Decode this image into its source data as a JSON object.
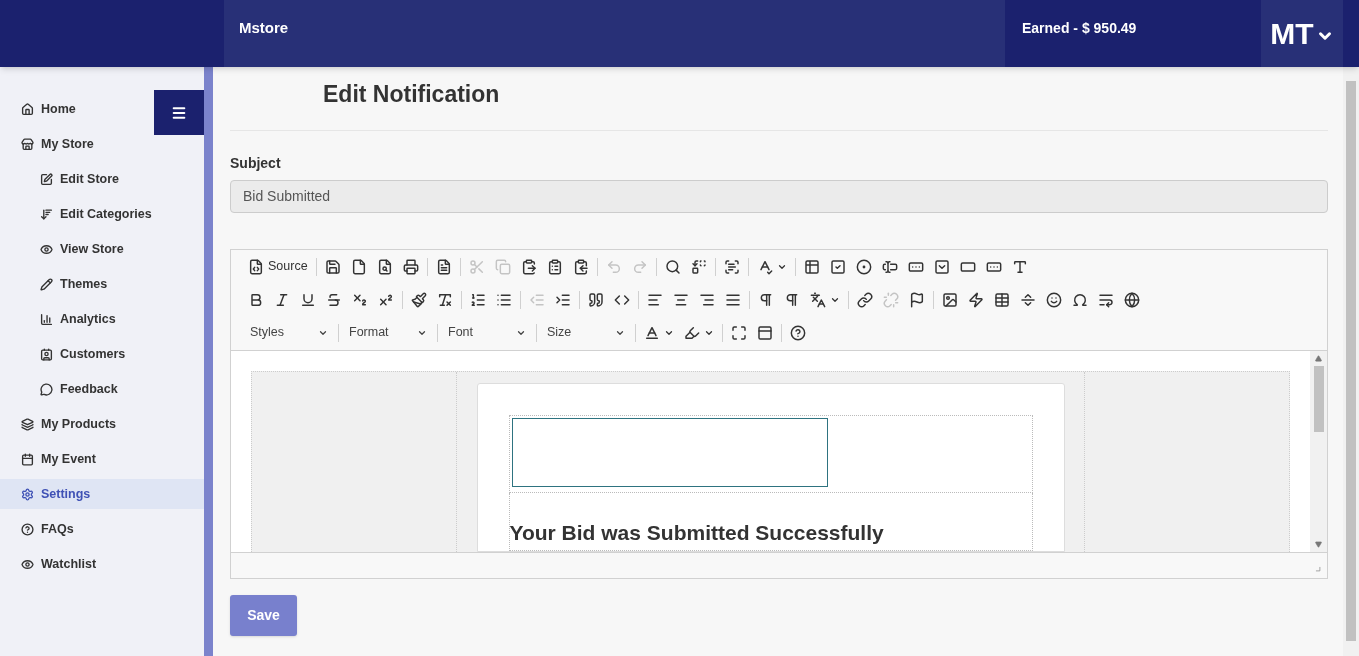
{
  "header": {
    "brand": "Mstore",
    "earned": "Earned - $ 950.49",
    "user_initials": "MT"
  },
  "sidebar": {
    "items": [
      {
        "kind": "home",
        "label": "Home",
        "selected": false
      },
      {
        "kind": "store",
        "label": "My Store",
        "selected": false,
        "children": [
          {
            "kind": "edit",
            "label": "Edit Store",
            "selected": false
          },
          {
            "kind": "sort",
            "label": "Edit Categories",
            "selected": false
          },
          {
            "kind": "eye",
            "label": "View Store",
            "selected": false
          },
          {
            "kind": "pencil",
            "label": "Themes",
            "selected": false
          },
          {
            "kind": "chart",
            "label": "Analytics",
            "selected": false
          },
          {
            "kind": "contact",
            "label": "Customers",
            "selected": false
          },
          {
            "kind": "comment",
            "label": "Feedback",
            "selected": false
          }
        ]
      },
      {
        "kind": "layers",
        "label": "My Products",
        "selected": false
      },
      {
        "kind": "calendar",
        "label": "My Event",
        "selected": false
      },
      {
        "kind": "gear",
        "label": "Settings",
        "selected": true
      },
      {
        "kind": "help",
        "label": "FAQs",
        "selected": false
      },
      {
        "kind": "eye",
        "label": "Watchlist",
        "selected": false
      }
    ]
  },
  "page": {
    "title": "Edit Notification",
    "subject_label": "Subject",
    "subject_value": "Bid Submitted"
  },
  "editor": {
    "toolbar_rows": [
      [
        [
          {
            "kind": "source",
            "label": "Source",
            "disabled": false
          }
        ],
        [
          {
            "kind": "save",
            "disabled": false
          },
          {
            "kind": "newpage",
            "disabled": false
          },
          {
            "kind": "preview",
            "disabled": false
          },
          {
            "kind": "print",
            "disabled": false
          }
        ],
        [
          {
            "kind": "templates",
            "disabled": false
          }
        ],
        [
          {
            "kind": "cut",
            "disabled": true
          },
          {
            "kind": "copy",
            "disabled": true
          },
          {
            "kind": "paste",
            "disabled": false
          },
          {
            "kind": "pastetext",
            "disabled": false
          },
          {
            "kind": "pasteword",
            "disabled": false
          }
        ],
        [
          {
            "kind": "undo",
            "disabled": true
          },
          {
            "kind": "redo",
            "disabled": true
          }
        ],
        [
          {
            "kind": "find",
            "disabled": false
          },
          {
            "kind": "replace",
            "disabled": false
          }
        ],
        [
          {
            "kind": "selectall",
            "disabled": false
          }
        ],
        [
          {
            "kind": "spell",
            "disabled": false,
            "dropdown": true
          }
        ],
        [
          {
            "kind": "form",
            "disabled": false
          },
          {
            "kind": "checkbox",
            "disabled": false
          },
          {
            "kind": "radio",
            "disabled": false
          },
          {
            "kind": "textfield",
            "disabled": false
          },
          {
            "kind": "textarea",
            "disabled": false
          },
          {
            "kind": "select",
            "disabled": false
          },
          {
            "kind": "button",
            "disabled": false
          },
          {
            "kind": "imagebutton",
            "disabled": false
          },
          {
            "kind": "hidden",
            "disabled": false
          }
        ]
      ],
      [
        [
          {
            "kind": "bold",
            "disabled": false
          },
          {
            "kind": "italic",
            "disabled": false
          },
          {
            "kind": "underline",
            "disabled": false
          },
          {
            "kind": "strike",
            "disabled": false
          },
          {
            "kind": "subscript",
            "disabled": false
          },
          {
            "kind": "superscript",
            "disabled": false
          }
        ],
        [
          {
            "kind": "copyformat",
            "disabled": false
          },
          {
            "kind": "removeformat",
            "disabled": false
          }
        ],
        [
          {
            "kind": "numbered",
            "disabled": false
          },
          {
            "kind": "bulleted",
            "disabled": false
          }
        ],
        [
          {
            "kind": "outdent",
            "disabled": true
          },
          {
            "kind": "indent",
            "disabled": false
          }
        ],
        [
          {
            "kind": "blockquote",
            "disabled": false
          },
          {
            "kind": "div",
            "disabled": false
          }
        ],
        [
          {
            "kind": "alignleft",
            "disabled": false
          },
          {
            "kind": "aligncenter",
            "disabled": false
          },
          {
            "kind": "alignright",
            "disabled": false
          },
          {
            "kind": "justify",
            "disabled": false
          }
        ],
        [
          {
            "kind": "ltr",
            "disabled": false
          },
          {
            "kind": "rtl",
            "disabled": false
          },
          {
            "kind": "language",
            "disabled": false,
            "dropdown": true
          }
        ],
        [
          {
            "kind": "link",
            "disabled": false
          },
          {
            "kind": "unlink",
            "disabled": true
          },
          {
            "kind": "anchor",
            "disabled": false
          }
        ],
        [
          {
            "kind": "image",
            "disabled": false
          },
          {
            "kind": "flash",
            "disabled": false
          },
          {
            "kind": "table",
            "disabled": false
          },
          {
            "kind": "hrule",
            "disabled": false
          },
          {
            "kind": "smiley",
            "disabled": false
          },
          {
            "kind": "special",
            "disabled": false
          },
          {
            "kind": "pagebreak",
            "disabled": false
          },
          {
            "kind": "iframe",
            "disabled": false
          }
        ]
      ]
    ],
    "combos": [
      {
        "label": "Styles"
      },
      {
        "label": "Format"
      },
      {
        "label": "Font"
      },
      {
        "label": "Size"
      }
    ],
    "tools": [
      [
        {
          "kind": "textcolor",
          "disabled": false,
          "dropdown": true
        },
        {
          "kind": "bgcolor",
          "disabled": false,
          "dropdown": true
        }
      ],
      [
        {
          "kind": "maximize",
          "disabled": false
        },
        {
          "kind": "showblocks",
          "disabled": false
        }
      ],
      [
        {
          "kind": "about",
          "disabled": false
        }
      ]
    ],
    "content_heading": "Your Bid was Submitted Successfully"
  },
  "save_button": "Save"
}
